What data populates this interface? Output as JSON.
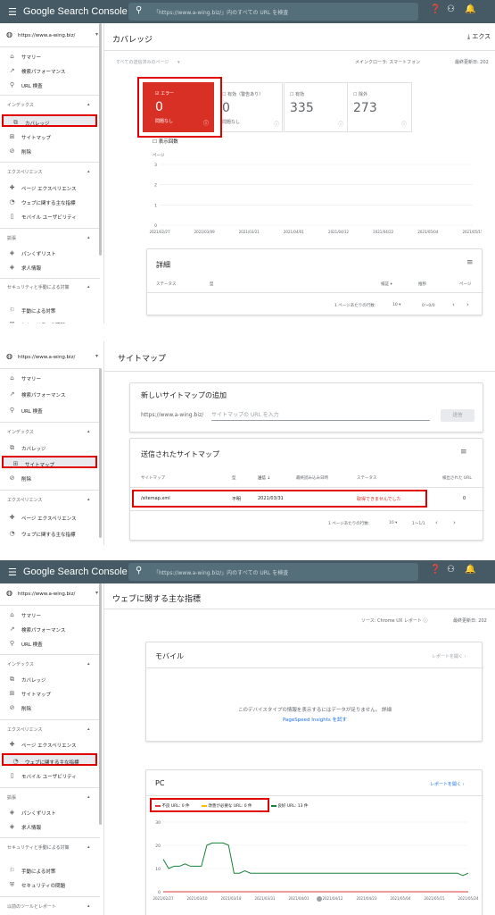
{
  "topbar": {
    "logo": "Google Search Console",
    "search_placeholder": "「https://www.a-wing.biz/」内のすべての URL を検査",
    "search_placeholder3": "「https://www.a-wing.biz/」内のすべての URL を検査"
  },
  "property": "https://www.a-wing.biz/",
  "panel1": {
    "title": "カバレッジ",
    "export": "エクス",
    "filter": "すべての送信済みのページ",
    "crawler": "メインクローラ: スマートフォン",
    "updated": "最終更新日: 202",
    "tiles": [
      {
        "label": "エラー",
        "value": "0",
        "sub": "問題なし"
      },
      {
        "label": "有効（警告あり）",
        "value": "0",
        "sub": "問題なし"
      },
      {
        "label": "有効",
        "value": "335",
        "sub": ""
      },
      {
        "label": "除外",
        "value": "273",
        "sub": ""
      }
    ],
    "impressions": "表示回数",
    "y_title": "ページ",
    "details_title": "詳細",
    "details_cols": {
      "status": "ステータス",
      "type": "型",
      "validation": "検証",
      "trend": "推移",
      "pages": "ページ"
    },
    "pager": {
      "rows_label": "1 ページあたりの行数:",
      "rows": "10",
      "range": "0～0/0"
    },
    "sidebar": {
      "summary": "サマリー",
      "performance": "検索パフォーマンス",
      "url_inspection": "URL 検査",
      "index_section": "インデックス",
      "coverage": "カバレッジ",
      "sitemaps": "サイトマップ",
      "removals": "削除",
      "experience_section": "エクスペリエンス",
      "page_experience": "ページ エクスペリエンス",
      "web_vitals": "ウェブに関する主な指標",
      "mobile_usability": "モバイル ユーザビリティ",
      "enhancements_section": "拡張",
      "breadcrumbs": "パンくずリスト",
      "job_postings": "求人情報",
      "security_section": "セキュリティと手動による対策",
      "manual_actions": "手動による対策",
      "security_issues": "セキュリティの問題"
    }
  },
  "panel2": {
    "title": "サイトマップ",
    "add_title": "新しいサイトマップの追加",
    "base_url": "https://www.a-wing.biz/",
    "input_placeholder": "サイトマップの URL を入力",
    "submit": "送信",
    "submitted_title": "送信されたサイトマップ",
    "cols": {
      "sitemap": "サイトマップ",
      "type": "型",
      "submitted": "送信",
      "last_read": "最終読み込み日時",
      "status": "ステータス",
      "urls": "検出された URL"
    },
    "row": {
      "sitemap": "/sitemap.xml",
      "type": "不明",
      "submitted": "2021/03/31",
      "last_read": "",
      "status": "取得できませんでした",
      "urls": "0"
    },
    "pager": {
      "rows_label": "1 ページあたりの行数:",
      "rows": "10",
      "range": "1～1/1"
    }
  },
  "panel3": {
    "title": "ウェブに関する主な指標",
    "source": "ソース: Chrome UX レポート",
    "updated": "最終更新日: 202",
    "mobile_title": "モバイル",
    "open_report": "レポートを開く",
    "no_data": "このデバイスタイプの情報を表示するにはデータが足りません。 詳細",
    "psi_link": "PageSpeed Insights を試す",
    "pc_title": "PC",
    "legend": [
      {
        "label": "不良 URL: 0 件",
        "color": "#e53935"
      },
      {
        "label": "改善が必要な URL: 0 件",
        "color": "#fbbc04"
      },
      {
        "label": "良好 URL: 13 件",
        "color": "#188038"
      }
    ],
    "sidebar_extra": {
      "other_tools": "以前のツールとレポート"
    }
  },
  "chart_data": [
    {
      "type": "line",
      "title": "",
      "x": [
        "2021/02/27",
        "2021/03/09",
        "2021/03/21",
        "2021/04/01",
        "2021/04/12",
        "2021/04/22",
        "2021/05/04",
        "2021/05/15"
      ],
      "yticks": [
        0,
        1,
        2,
        3
      ],
      "ylim": [
        0,
        3
      ],
      "series": [],
      "grid": true
    },
    {
      "type": "line",
      "title": "",
      "x": [
        "2021/02/27",
        "2021/03/10",
        "2021/03/18",
        "2021/03/31",
        "2021/04/01",
        "2021/04/12",
        "2021/04/23",
        "2021/05/04",
        "2021/05/15",
        "2021/05/24"
      ],
      "yticks": [
        0,
        10,
        20,
        30
      ],
      "ylim": [
        0,
        30
      ],
      "grid": true,
      "series": [
        {
          "name": "良好 URL: 13 件",
          "color": "#188038",
          "values": [
            14,
            10,
            11,
            11,
            12,
            11,
            11,
            11,
            20,
            21,
            21,
            21,
            20,
            8,
            8,
            9,
            8,
            8,
            8,
            8,
            8,
            8,
            8,
            8,
            8,
            8,
            8,
            8,
            8,
            8,
            8,
            8,
            8,
            8,
            8,
            8,
            8,
            8,
            8,
            8,
            8,
            8,
            8,
            8,
            8,
            8,
            8,
            8,
            8,
            8,
            8,
            8,
            8,
            8,
            8,
            7,
            8
          ]
        },
        {
          "name": "不良 URL: 0 件",
          "color": "#e53935",
          "values": [
            0,
            0,
            0,
            0,
            0,
            0,
            0,
            0,
            0,
            0,
            0,
            0,
            0,
            0,
            0,
            0,
            0,
            0,
            0,
            0,
            0,
            0,
            0,
            0,
            0,
            0,
            0,
            0,
            0,
            0,
            0,
            0,
            0,
            0,
            0,
            0,
            0,
            0,
            0,
            0,
            0,
            0,
            0,
            0,
            0,
            0,
            0,
            0,
            0,
            0,
            0,
            0,
            0,
            0,
            0,
            0,
            0
          ]
        }
      ]
    }
  ]
}
